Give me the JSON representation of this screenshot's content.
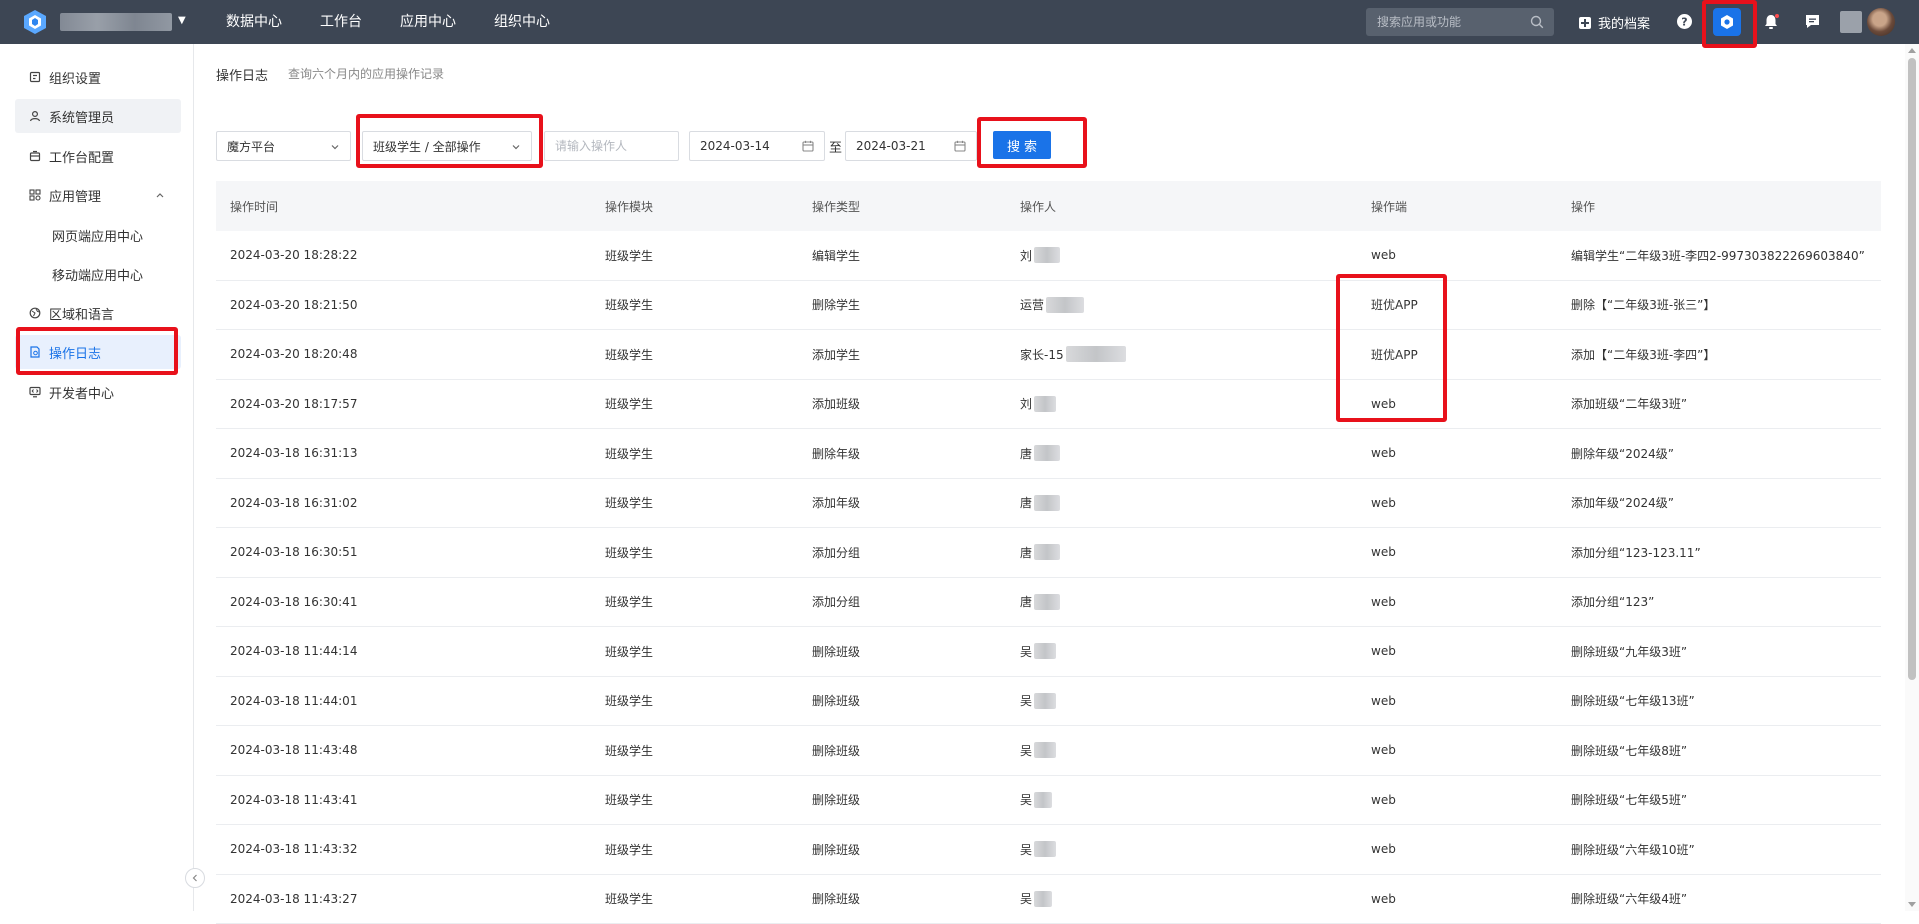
{
  "header": {
    "nav": [
      "数据中心",
      "工作台",
      "应用中心",
      "组织中心"
    ],
    "search_placeholder": "搜索应用或功能",
    "archive_label": "我的档案"
  },
  "sidebar": {
    "items": [
      {
        "label": "组织设置",
        "icon": "org-settings-icon"
      },
      {
        "label": "系统管理员",
        "icon": "admin-icon"
      },
      {
        "label": "工作台配置",
        "icon": "workbench-icon"
      },
      {
        "label": "应用管理",
        "icon": "app-manage-icon"
      },
      {
        "label": "网页端应用中心",
        "icon": ""
      },
      {
        "label": "移动端应用中心",
        "icon": ""
      },
      {
        "label": "区域和语言",
        "icon": "globe-icon"
      },
      {
        "label": "操作日志",
        "icon": "log-icon"
      },
      {
        "label": "开发者中心",
        "icon": "developer-icon"
      }
    ]
  },
  "page": {
    "title": "操作日志",
    "subtitle": "查询六个月内的应用操作记录"
  },
  "filters": {
    "platform": "魔方平台",
    "scope": "班级学生 / 全部操作",
    "operator_placeholder": "请输入操作人",
    "date_from": "2024-03-14",
    "range_sep": "至",
    "date_to": "2024-03-21",
    "search_label": "搜索"
  },
  "table": {
    "columns": [
      "操作时间",
      "操作模块",
      "操作类型",
      "操作人",
      "操作端",
      "操作"
    ],
    "rows": [
      [
        "2024-03-20 18:28:22",
        "班级学生",
        "编辑学生",
        "刘",
        "web",
        "编辑学生“二年级3班-李四2-997303822269603840”"
      ],
      [
        "2024-03-20 18:21:50",
        "班级学生",
        "删除学生",
        "运营",
        "班优APP",
        "删除【“二年级3班-张三”】"
      ],
      [
        "2024-03-20 18:20:48",
        "班级学生",
        "添加学生",
        "家长-15",
        "班优APP",
        "添加【“二年级3班-李四”】"
      ],
      [
        "2024-03-20 18:17:57",
        "班级学生",
        "添加班级",
        "刘",
        "web",
        "添加班级“二年级3班”"
      ],
      [
        "2024-03-18 16:31:13",
        "班级学生",
        "删除年级",
        "唐",
        "web",
        "删除年级“2024级”"
      ],
      [
        "2024-03-18 16:31:02",
        "班级学生",
        "添加年级",
        "唐",
        "web",
        "添加年级“2024级”"
      ],
      [
        "2024-03-18 16:30:51",
        "班级学生",
        "添加分组",
        "唐",
        "web",
        "添加分组“123-123.11”"
      ],
      [
        "2024-03-18 16:30:41",
        "班级学生",
        "添加分组",
        "唐",
        "web",
        "添加分组“123”"
      ],
      [
        "2024-03-18 11:44:14",
        "班级学生",
        "删除班级",
        "吴",
        "web",
        "删除班级“九年级3班”"
      ],
      [
        "2024-03-18 11:44:01",
        "班级学生",
        "删除班级",
        "吴",
        "web",
        "删除班级“七年级13班”"
      ],
      [
        "2024-03-18 11:43:48",
        "班级学生",
        "删除班级",
        "吴",
        "web",
        "删除班级“七年级8班”"
      ],
      [
        "2024-03-18 11:43:41",
        "班级学生",
        "删除班级",
        "吴",
        "web",
        "删除班级“七年级5班”"
      ],
      [
        "2024-03-18 11:43:32",
        "班级学生",
        "删除班级",
        "吴",
        "web",
        "删除班级“六年级10班”"
      ],
      [
        "2024-03-18 11:43:27",
        "班级学生",
        "删除班级",
        "吴",
        "web",
        "删除班级“六年级4班”"
      ]
    ]
  },
  "colors": {
    "topbar": "#3d4654",
    "accent": "#1a73e8",
    "highlight": "#e8111b"
  }
}
